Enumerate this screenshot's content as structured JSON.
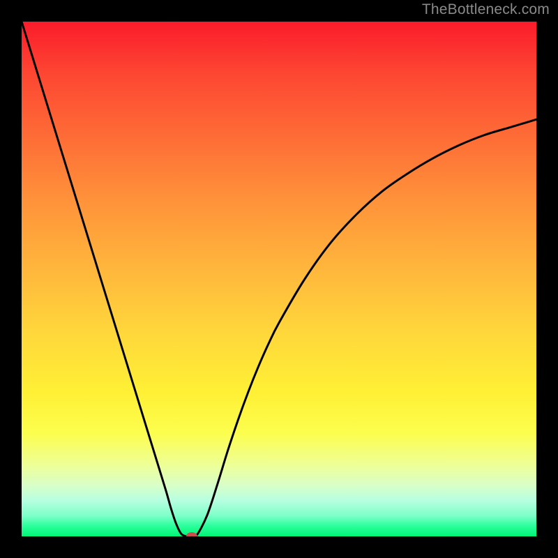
{
  "watermark": {
    "text": "TheBottleneck.com"
  },
  "colors": {
    "frame": "#000000",
    "curve": "#000000",
    "marker": "#c94f4f"
  },
  "chart_data": {
    "type": "line",
    "title": "",
    "xlabel": "",
    "ylabel": "",
    "xlim": [
      0,
      100
    ],
    "ylim": [
      0,
      100
    ],
    "grid": false,
    "x": [
      0,
      2,
      4,
      6,
      8,
      10,
      12,
      14,
      16,
      18,
      20,
      22,
      24,
      26,
      28,
      29,
      30,
      31,
      32,
      33,
      34,
      36,
      38,
      40,
      42,
      44,
      46,
      48,
      50,
      55,
      60,
      65,
      70,
      75,
      80,
      85,
      90,
      95,
      100
    ],
    "values": [
      100,
      93.5,
      87,
      80.5,
      74,
      67.5,
      61,
      54.5,
      48,
      41.5,
      35,
      28.5,
      22,
      15.5,
      9,
      5.5,
      2.5,
      0.5,
      0,
      0,
      0.2,
      4,
      10,
      16.5,
      22.5,
      28,
      33,
      37.5,
      41.5,
      50,
      57,
      62.5,
      67,
      70.5,
      73.5,
      76,
      78,
      79.5,
      81
    ],
    "marker": {
      "x": 33,
      "y": 0
    },
    "annotations": []
  }
}
